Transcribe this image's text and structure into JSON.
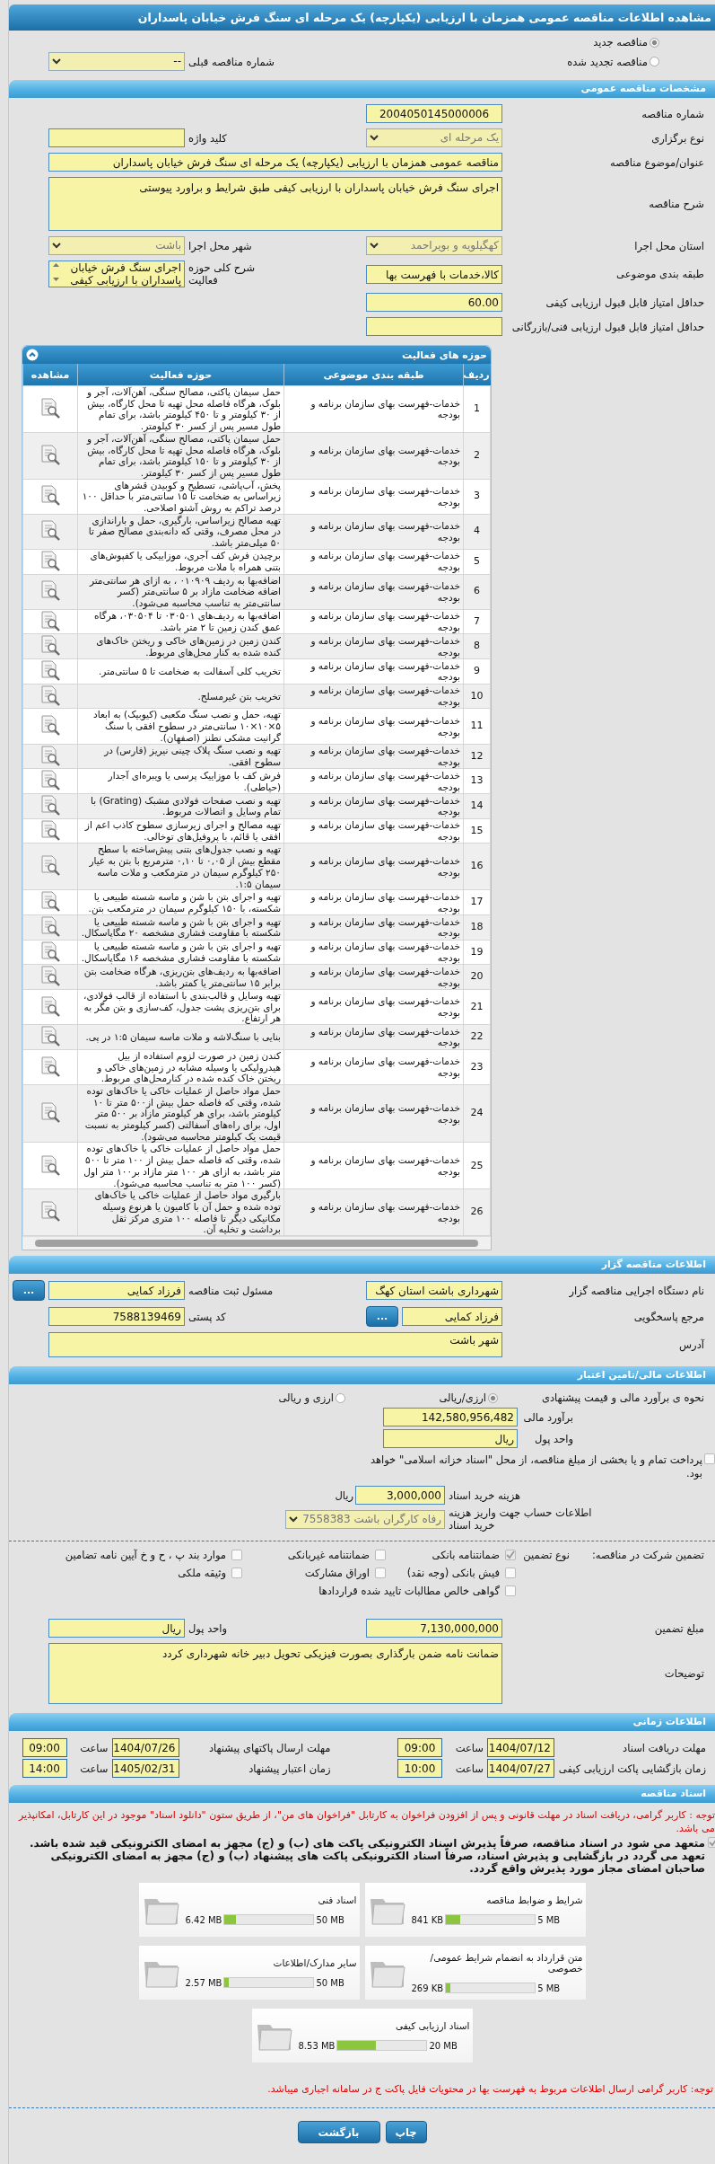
{
  "title": "مشاهده اطلاعات مناقصه عمومی همزمان با ارزیابی (یکپارچه) یک مرحله ای سنگ فرش خیابان پاسداران",
  "tender_status": [
    {
      "label": "مناقصه جدید",
      "selected": true
    },
    {
      "label": "مناقصه تجدید شده",
      "selected": false
    }
  ],
  "previous_tender": {
    "label": "شماره مناقصه قبلی",
    "value": "--"
  },
  "general": {
    "heading": "مشخصات مناقصه عمومی",
    "rows": [
      [
        {
          "label": "شماره مناقصه",
          "kind": "code",
          "value": "2004050145000006"
        }
      ],
      [
        {
          "label": "نوع برگزاری",
          "kind": "select",
          "value": "یک مرحله ای"
        },
        {
          "label": "کلید واژه",
          "kind": "input"
        }
      ],
      [
        {
          "label": "عنوان/موضوع مناقصه",
          "kind": "wide",
          "value": "مناقصه عمومی همزمان با ارزیابی (یکپارچه) یک مرحله ای سنگ فرش خیابان پاسداران"
        }
      ],
      [
        {
          "label": "شرح مناقصه",
          "kind": "textarea",
          "value": "اجرای سنگ فرش خیابان پاسداران با ارزیابی کیفی طبق شرایط و براورد پیوستی"
        }
      ],
      [
        {
          "label": "استان محل اجرا",
          "kind": "select",
          "value": "کهگیلویه و بویراحمد"
        },
        {
          "label": "شهر محل اجرا",
          "kind": "select",
          "value": "باشت"
        }
      ],
      [
        {
          "label": "طبقه بندی موضوعی",
          "kind": "input",
          "value": "کالا،خدمات با فهرست بها"
        },
        {
          "label": "شرح کلی حوزه فعالیت",
          "kind": "listbox",
          "value": "اجرای سنگ فرش خیابان پاسداران با ارزیابی کیفی"
        }
      ],
      [
        {
          "label": "حداقل امتیاز قابل قبول ارزیابی کیفی",
          "kind": "input",
          "value": "60.00"
        }
      ],
      [
        {
          "label": "حداقل امتیاز قابل قبول ارزیابی فنی/بازرگانی",
          "kind": "input"
        }
      ]
    ]
  },
  "activities": {
    "heading": "حوزه های فعالیت",
    "columns": [
      "ردیف",
      "طبقه بندی موضوعی",
      "حوزه فعالیت",
      "مشاهده"
    ],
    "rows": [
      {
        "index": "1",
        "category": "خدمات-فهرست بهای سازمان برنامه و بودجه",
        "activity": "حمل سیمان پاکتی، مصالح سنگی، آهن‌آلات، آجر و بلوک، هرگاه فاصله محل تهیه تا محل کارگاه، بیش از ۳۰ کیلومتر و تا ۴۵۰ کیلومتر باشد، برای تمام طول مسیر پس از کسر ۳۰ کیلومتر."
      },
      {
        "index": "2",
        "category": "خدمات-فهرست بهای سازمان برنامه و بودجه",
        "activity": "حمل سیمان پاکتی، مصالح سنگی، آهن‌آلات، آجر و بلوک، هرگاه فاصله محل تهیه تا محل کارگاه، بیش از ۳۰ کیلومتر و تا ۱۵۰ کیلومتر باشد، برای تمام طول مسیر پس از کسر ۳۰ کیلومتر."
      },
      {
        "index": "3",
        "category": "خدمات-فهرست بهای سازمان برنامه و بودجه",
        "activity": "پخش، آب‌پاشی، تسطیح و کوبیدن قشرهای زیراساس به ضخامت تا ۱۵ سانتی‌متر با حداقل ۱۰۰ درصد تراکم به روش آشتو اصلاحی."
      },
      {
        "index": "4",
        "category": "خدمات-فهرست بهای سازمان برنامه و بودجه",
        "activity": "تهیه مصالح زیراساس، بارگیری، حمل و باراندازی در محل مصرف، وقتی که دانه‌بندی مصالح صفر تا ۵۰ میلی‌متر باشد."
      },
      {
        "index": "5",
        "category": "خدمات-فهرست بهای سازمان برنامه و بودجه",
        "activity": "برچیدن فرش کف آجری، موزاییکی یا کفپوش‌های بتنی همراه با ملات مربوط."
      },
      {
        "index": "6",
        "category": "خدمات-فهرست بهای سازمان برنامه و بودجه",
        "activity": "اضافه‌بها به ردیف ۰۱۰۹۰۹ ، به ازای هر سانتی‌متر اضافه ضخامت مازاد بر ۵ سانتی‌متر (کسر سانتی‌متر به تناسب محاسبه می‌شود)."
      },
      {
        "index": "7",
        "category": "خدمات-فهرست بهای سازمان برنامه و بودجه",
        "activity": "اضافه‌بها به ردیف‌های ۰۳۰۵۰۱ تا ۰۳۰۵۰۴، هرگاه عمق کندن  زمین تا ۲ متر باشد."
      },
      {
        "index": "8",
        "category": "خدمات-فهرست بهای سازمان برنامه و بودجه",
        "activity": "کندن زمین در زمین‌های خاکی و ریختن خاک‌های کنده شده به کنار محل‌های مربوط."
      },
      {
        "index": "9",
        "category": "خدمات-فهرست بهای سازمان برنامه و بودجه",
        "activity": "تخریب کلی آسفالت  به ضخامت تا ۵ سانتی‌متر."
      },
      {
        "index": "10",
        "category": "خدمات-فهرست بهای سازمان برنامه و بودجه",
        "activity": "تخریب بتن غیرمسلح."
      },
      {
        "index": "11",
        "category": "خدمات-فهرست بهای سازمان برنامه و بودجه",
        "activity": "تهیه، حمل و نصب سنگ مکعبی (کیوبیک) به ابعاد ۵×۱۰×۱۰ سانتی‌متر در سطوح افقی با سنگ گرانیت مشکی نطنز (اصفهان)."
      },
      {
        "index": "12",
        "category": "خدمات-فهرست بهای سازمان برنامه و بودجه",
        "activity": "تهیه و نصب سنگ پلاک چینی نیریز (فارس) در سطوح افقی."
      },
      {
        "index": "13",
        "category": "خدمات-فهرست بهای سازمان برنامه و بودجه",
        "activity": "فرش کف با موزاییک پرسی یا ویبره‌ای آجدار (حیاطی)."
      },
      {
        "index": "14",
        "category": "خدمات-فهرست بهای سازمان برنامه و بودجه",
        "activity": "تهیه و نصب صفحات فولادی مشبک (Grating) با تمام وسایل و اتصالات مربوط."
      },
      {
        "index": "15",
        "category": "خدمات-فهرست بهای سازمان برنامه و بودجه",
        "activity": "تهیه مصالح و اجرای زیرسازی سطوح کاذب اعم از افقی یا قائم، با پروفیل‌های توخالی."
      },
      {
        "index": "16",
        "category": "خدمات-فهرست بهای سازمان برنامه و بودجه",
        "activity": "تهیه و نصب جدول‌های بتنی پیش‌ساخته با سطح مقطع بیش از ۰,۰۵ تا ۰,۱۰ مترمربع با بتن به عیار ۲۵۰ کیلوگرم سیمان در مترمکعب و ملات ماسه سیمان ۱:۵."
      },
      {
        "index": "17",
        "category": "خدمات-فهرست بهای سازمان برنامه و بودجه",
        "activity": "تهیه و اجرای بتن با شن و ماسه شسته طبیعی یا شکسته، با ۱۵۰ کیلوگرم سیمان در مترمکعب بتن."
      },
      {
        "index": "18",
        "category": "خدمات-فهرست بهای سازمان برنامه و بودجه",
        "activity": "تهیه و اجرای بتن با شن و ماسه شسته طبیعی یا شکسته با مقاومت فشاری مشخصه ۲۰ مگاپاسکال."
      },
      {
        "index": "19",
        "category": "خدمات-فهرست بهای سازمان برنامه و بودجه",
        "activity": "تهیه و اجرای بتن با شن و ماسه شسته طبیعی یا شکسته با مقاومت فشاری مشخصه ۱۶ مگاپاسکال."
      },
      {
        "index": "20",
        "category": "خدمات-فهرست بهای سازمان برنامه و بودجه",
        "activity": "اضافه‌بها به ردیف‌های بتن‌ریزی، هرگاه ضخامت بتن برابر ۱۵ سانتی‌متر یا کمتر باشد."
      },
      {
        "index": "21",
        "category": "خدمات-فهرست بهای سازمان برنامه و بودجه",
        "activity": "تهیه وسایل و قالب‌بندی با استفاده از قالب فولادی، برای بتن‌ریزی پشت جدول، کف‌سازی و بتن مگر به هر ارتفاع."
      },
      {
        "index": "22",
        "category": "خدمات-فهرست بهای سازمان برنامه و بودجه",
        "activity": "بنایی با سنگ‌لاشه و ملات ماسه سیمان ۱:۵ در پی."
      },
      {
        "index": "23",
        "category": "خدمات-فهرست بهای سازمان برنامه و بودجه",
        "activity": "کندن زمین در صورت لزوم استفاده از بیل هیدرولیکی یا  وسیله مشابه در زمین‌های خاکی و ریختن خاک کنده شده در کنارمحل‌های مربوط."
      },
      {
        "index": "24",
        "category": "خدمات-فهرست بهای سازمان برنامه و بودجه",
        "activity": "حمل مواد حاصل از عملیات خاکی یا خاک‌های توده شده، وقتی  که فاصله حمل بیش از۵۰۰ متر تا ۱۰ کیلومتر باشد، برای هر کیلومتر مازاد بر ۵۰۰  متر اول، برای راه‌های آسفالتی (کسر کیلومتر به نسبت قیمت یک کیلومتر محاسبه می‌شود)."
      },
      {
        "index": "25",
        "category": "خدمات-فهرست بهای سازمان برنامه و بودجه",
        "activity": "حمل مواد حاصل از عملیات خاکی یا خاک‌های توده شده، وقتی که فاصله حمل بیش از ۱۰۰ متر تا ۵۰۰ متر باشد، به ازای هر ۱۰۰ متر مازاد بر۱۰۰ متر اول (کسر ۱۰۰ متر به تناسب محاسبه می‌شود)."
      },
      {
        "index": "26",
        "category": "خدمات-فهرست بهای سازمان برنامه و بودجه",
        "activity": "بارگیری مواد حاصل از عملیات خاکی یا خاک‌های توده شده و  حمل آن با کامیون یا هرنوع وسیله مکانیکی دیگر تا فاصله ۱۰۰ متری مرکز ثقل برداشت و تخلیه آن."
      }
    ]
  },
  "organizer": {
    "heading": "اطلاعات مناقصه گزار",
    "rows": [
      [
        {
          "label": "نام دستگاه اجرایی مناقصه گزار",
          "kind": "input",
          "value": "شهرداری باشت استان کهگ"
        },
        {
          "label": "مسئول ثبت مناقصه",
          "kind": "input",
          "value": "فرزاد  کمایی",
          "button": "..."
        }
      ],
      [
        {
          "label": "مرجع پاسخگویی",
          "kind": "input",
          "value": "فرزاد کمایی",
          "button": "..."
        },
        {
          "label": "کد پستی",
          "kind": "input",
          "value": "7588139469"
        }
      ],
      [
        {
          "label": "آدرس",
          "kind": "address",
          "value": "شهر باشت"
        }
      ]
    ]
  },
  "finance": {
    "heading": "اطلاعات مالی/تامین اعتبار",
    "estimate_method": {
      "label": "نحوه ی برآورد مالی و قیمت پیشنهادی",
      "options": [
        {
          "label": "ارزی/ریالی",
          "selected": true
        },
        {
          "label": "ارزی و ریالی",
          "selected": false
        }
      ]
    },
    "estimate": {
      "label": "برآورد مالی",
      "value": "142,580,956,482"
    },
    "currency": {
      "label": "واحد پول",
      "value": "ریال"
    },
    "treasury": {
      "label": "پرداخت تمام و یا بخشی از مبلغ مناقصه، از محل \"اسناد خزانه اسلامی\" خواهد بود.",
      "checked": false
    },
    "document_fee": {
      "label": "هزینه خرید اسناد",
      "value": "3,000,000",
      "unit": "ریال"
    },
    "account": {
      "label": "اطلاعات حساب جهت واریز هزینه خرید اسناد",
      "value": "رفاه کارگران باشت 7558383"
    }
  },
  "guarantee": {
    "label": "تضمین شرکت در مناقصه:",
    "type_label": "نوع تضمین",
    "options": [
      {
        "label": "ضمانتنامه بانکی",
        "checked": true
      },
      {
        "label": "ضمانتنامه غیربانکی",
        "checked": false
      },
      {
        "label": "موارد بند پ ، ح و خ آیین نامه تضامین",
        "checked": false
      },
      {
        "label": "فیش بانکی (وجه نقد)",
        "checked": false
      },
      {
        "label": "اوراق مشارکت",
        "checked": false
      },
      {
        "label": "وثیقه ملکی",
        "checked": false
      },
      {
        "label": "گواهی خالص مطالبات تایید شده قراردادها",
        "checked": false
      }
    ],
    "amount": {
      "label": "مبلغ تضمین",
      "value": "7,130,000,000"
    },
    "currency": {
      "label": "واحد پول",
      "value": "ریال"
    },
    "notes": {
      "label": "توضیحات",
      "value": "ضمانت نامه ضمن بارگذاری بصورت فیزیکی تحویل دبیر خانه شهرداری کردد"
    }
  },
  "schedule": {
    "heading": "اطلاعات زمانی",
    "items": [
      {
        "label": "مهلت دریافت اسناد",
        "date": "1404/07/12",
        "time_label": "ساعت",
        "time": "09:00"
      },
      {
        "label": "مهلت ارسال پاکتهای پیشنهاد",
        "date": "1404/07/26",
        "time_label": "ساعت",
        "time": "09:00"
      },
      {
        "label": "زمان بازگشایی پاکت ارزیابی کیفی",
        "date": "1404/07/27",
        "time_label": "ساعت",
        "time": "10:00"
      },
      {
        "label": "زمان اعتبار پیشنهاد",
        "date": "1405/02/31",
        "time_label": "ساعت",
        "time": "14:00"
      }
    ]
  },
  "documents": {
    "heading": "اسناد مناقصه",
    "notice": "توجه : کاربر گرامی، دریافت اسناد در مهلت قانونی و پس از افزودن فراخوان به کارتابل \"فراخوان های من\"، از طریق ستون \"دانلود اسناد\" موجود در این کارتابل، امکانپذیر می باشد.",
    "commitment": {
      "text": "متعهد می شود در اسناد مناقصه، صرفاً پذیرش اسناد الکترونیکی پاکت های (ب) و (ج) مجهز به امضای الکترونیکی قید شده باشد. تعهد می گردد در بازگشایی و پذیرش اسناد، صرفاً اسناد الکترونیکی پاکت های پیشنهاد (ب) و (ج) مجهز به امضای الکترونیکی صاحبان امضای مجاز مورد پذیرش واقع گردد.",
      "checked": true
    },
    "files": [
      {
        "name": "شرایط و ضوابط مناقصه",
        "size": "841 KB",
        "max": "5 MB",
        "level": 0.16
      },
      {
        "name": "اسناد فنی",
        "size": "6.42 MB",
        "max": "50 MB",
        "level": 0.13
      },
      {
        "name": "متن قرارداد به انضمام شرایط عمومی/خصوصی",
        "size": "269 KB",
        "max": "5 MB",
        "level": 0.05
      },
      {
        "name": "سایر مدارک/اطلاعات",
        "size": "2.57 MB",
        "max": "50 MB",
        "level": 0.05
      },
      {
        "name": "اسناد ارزیابی کیفی",
        "size": "8.53 MB",
        "max": "20 MB",
        "level": 0.43
      }
    ],
    "warning": "توجه: کاربر گرامی ارسال اطلاعات مربوط به فهرست بها در محتویات فایل پاکت ج در سامانه اجباری میباشد."
  },
  "buttons": [
    "چاپ",
    "بازگشت"
  ]
}
